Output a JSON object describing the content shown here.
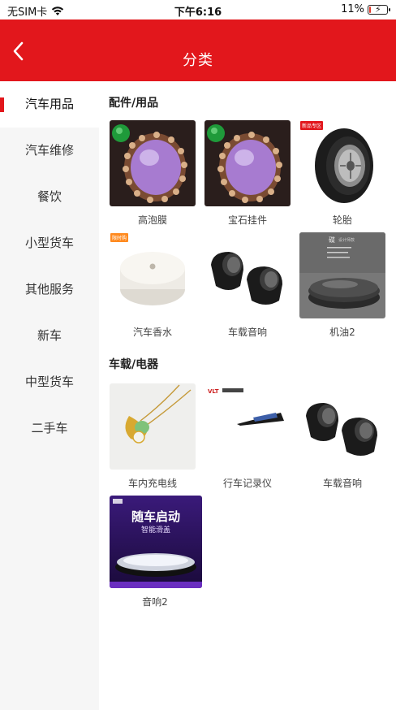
{
  "status_bar": {
    "carrier": "无SIM卡",
    "time": "下午6:16",
    "battery": "11%",
    "battery_level": 0.11
  },
  "nav": {
    "title": "分类"
  },
  "sidebar": {
    "items": [
      {
        "label": "汽车用品",
        "active": true
      },
      {
        "label": "汽车维修"
      },
      {
        "label": "餐饮"
      },
      {
        "label": "小型货车"
      },
      {
        "label": "其他服务"
      },
      {
        "label": "新车"
      },
      {
        "label": "中型货车"
      },
      {
        "label": "二手车"
      }
    ]
  },
  "sections": [
    {
      "title": "配件/用品",
      "items": [
        {
          "label": "高泡膜",
          "icon": "jade-pendant-image"
        },
        {
          "label": "宝石挂件",
          "icon": "jade-pendant-image"
        },
        {
          "label": "轮胎",
          "icon": "tire-image",
          "tag": "新品专区"
        },
        {
          "label": "汽车香水",
          "icon": "air-freshener-image",
          "tag": "限时购"
        },
        {
          "label": "车载音响",
          "icon": "speaker-image"
        },
        {
          "label": "机油2",
          "icon": "aroma-diffuser-image"
        }
      ]
    },
    {
      "title": "车载/电器",
      "items": [
        {
          "label": "车内充电线",
          "icon": "jade-necklace-image"
        },
        {
          "label": "行车记录仪",
          "icon": "dashcam-image"
        },
        {
          "label": "车载音响",
          "icon": "speaker-image"
        },
        {
          "label": "音响2",
          "icon": "car-diffuser-ad-image",
          "ad_text": "随车启动",
          "ad_sub": "智能滑盖"
        }
      ]
    }
  ],
  "colors": {
    "accent": "#e2171c",
    "sidebar_bg": "#f6f6f6"
  }
}
